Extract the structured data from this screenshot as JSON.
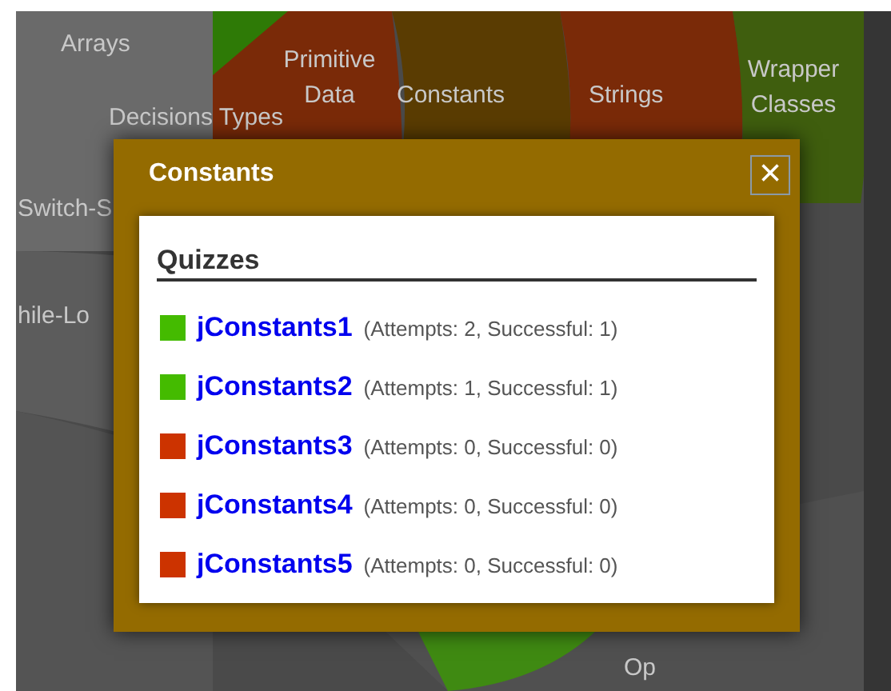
{
  "chart_labels": [
    {
      "text": "Arrays"
    },
    {
      "text": "Primitive Data"
    },
    {
      "text": "Constants"
    },
    {
      "text": "Strings"
    },
    {
      "text": "Wrapper Classes"
    },
    {
      "text": "Decisions Types"
    },
    {
      "text": "Switch-S"
    },
    {
      "text": "hile-Lo"
    },
    {
      "text": "Op"
    }
  ],
  "dialog": {
    "title": "Constants",
    "close": "×",
    "section": "Quizzes",
    "quizzes": [
      {
        "name": "jConstants1",
        "stats": "(Attempts: 2, Successful: 1)",
        "color": "#44bb00"
      },
      {
        "name": "jConstants2",
        "stats": "(Attempts: 1, Successful: 1)",
        "color": "#44bb00"
      },
      {
        "name": "jConstants3",
        "stats": "(Attempts: 0, Successful: 0)",
        "color": "#cc3300"
      },
      {
        "name": "jConstants4",
        "stats": "(Attempts: 0, Successful: 0)",
        "color": "#cc3300"
      },
      {
        "name": "jConstants5",
        "stats": "(Attempts: 0, Successful: 0)",
        "color": "#cc3300"
      }
    ]
  }
}
